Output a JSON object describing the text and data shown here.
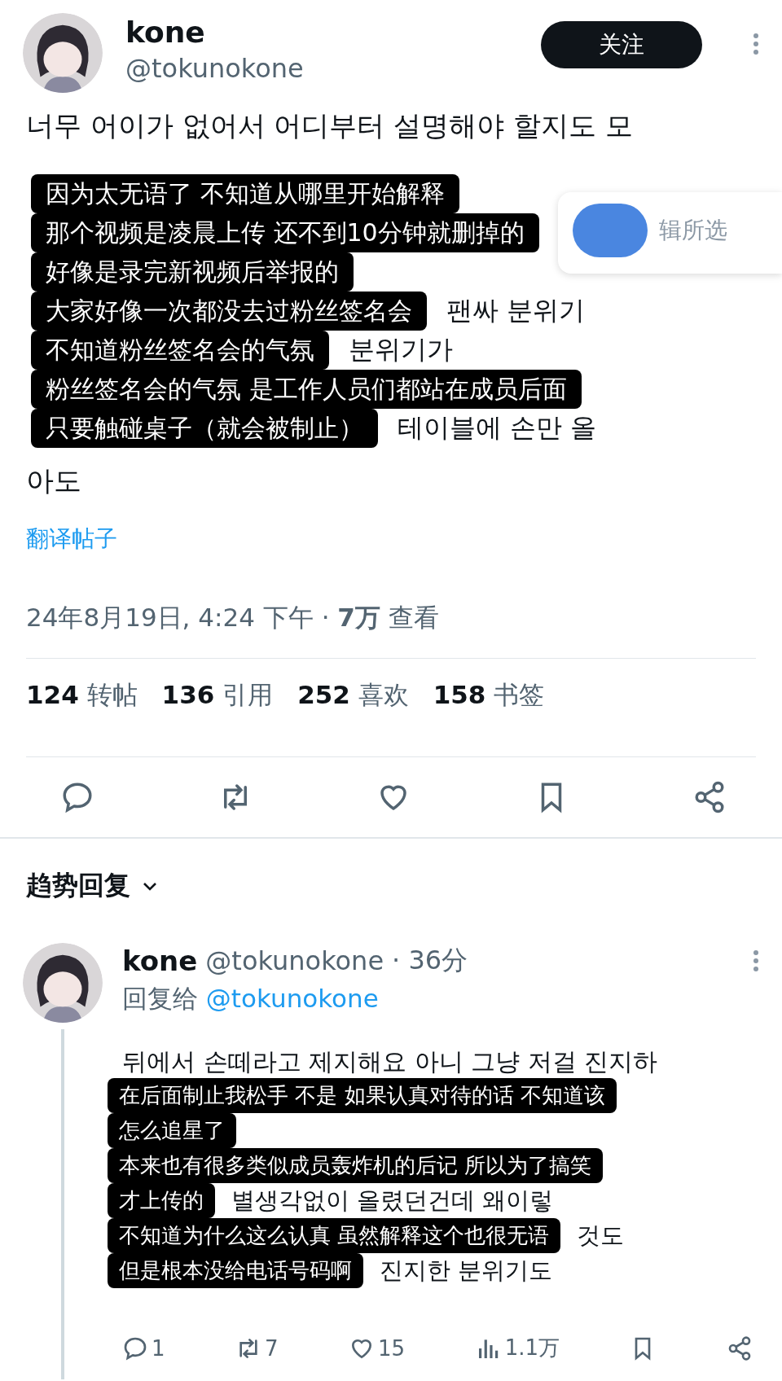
{
  "post": {
    "name": "kone",
    "handle": "@tokunokone",
    "follow_label": "关注",
    "text_first": "너무 어이가 없어서 어디부터 설명해야 할지도 모",
    "subtitles": [
      {
        "text": "因为太无语了 不知道从哪里开始解释"
      },
      {
        "text": "那个视频是凌晨上传 还不到10分钟就删掉的"
      },
      {
        "text": "好像是录完新视频后举报的"
      },
      {
        "text": "大家好像一次都没去过粉丝签名会",
        "behind": "팬싸 분위기"
      },
      {
        "text": "不知道粉丝签名会的气氛",
        "behind": "분위기가"
      },
      {
        "text": "粉丝签名会的气氛 是工作人员们都站在成员后面"
      },
      {
        "text": "只要触碰桌子（就会被制止）",
        "behind": "테이블에 손만 올"
      }
    ],
    "popup_text": "辑所选",
    "text_last": "아도",
    "translate": "翻译帖子",
    "timestamp": "24年8月19日, 4:24 下午 · **7万** 查看",
    "stats": [
      {
        "count": "124",
        "label": "转帖"
      },
      {
        "count": "136",
        "label": "引用"
      },
      {
        "count": "252",
        "label": "喜欢"
      },
      {
        "count": "158",
        "label": "书签"
      }
    ]
  },
  "replies_header": "趋势回复",
  "reply": {
    "name": "kone",
    "handle": "@tokunokone",
    "time": "· 36分",
    "reply_to_label": "回复给",
    "reply_to": "@tokunokone",
    "text_first": "뒤에서 손떼라고 제지해요 아니 그냥 저걸 진지하",
    "subtitles": [
      {
        "text": "在后面制止我松手 不是 如果认真对待的话 不知道该"
      },
      {
        "text": "怎么追星了"
      },
      {
        "text": "本来也有很多类似成员轰炸机的后记 所以为了搞笑"
      },
      {
        "text": "才上传的",
        "behind": "별생각없이 올렸던건데 왜이렇"
      },
      {
        "text": "不知道为什么这么认真 虽然解释这个也很无语",
        "behind": "것도"
      },
      {
        "text": "但是根本没给电话号码啊",
        "behind": "진지한 분위기도"
      }
    ],
    "actions": [
      {
        "kind": "reply",
        "count": "1"
      },
      {
        "kind": "repost",
        "count": "7"
      },
      {
        "kind": "like",
        "count": "15"
      },
      {
        "kind": "views",
        "count": "1.1万"
      },
      {
        "kind": "bookmark"
      },
      {
        "kind": "share"
      }
    ]
  }
}
